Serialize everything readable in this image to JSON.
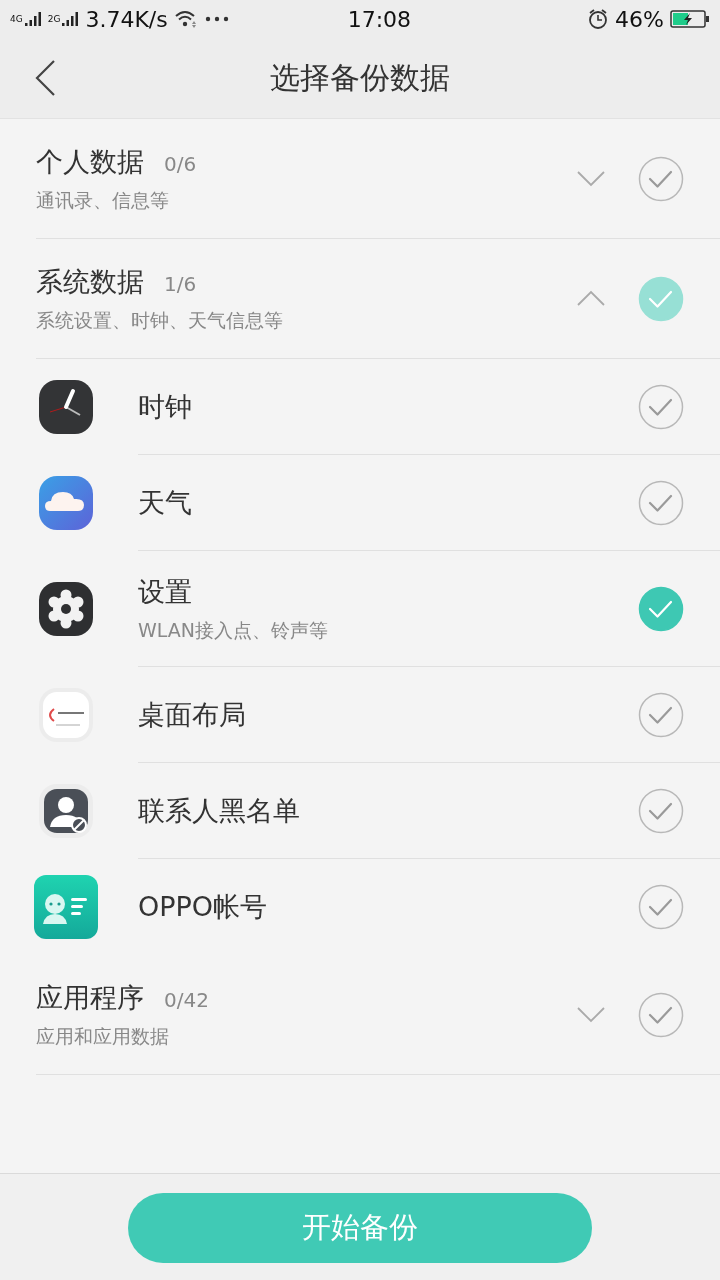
{
  "status_bar": {
    "network_1": "4G",
    "network_2": "2G",
    "speed": "3.74K/s",
    "time": "17:08",
    "battery": "46%"
  },
  "header": {
    "title": "选择备份数据"
  },
  "groups": [
    {
      "title": "个人数据",
      "count": "0/6",
      "subtitle": "通讯录、信息等",
      "expanded": false,
      "checked": false
    },
    {
      "title": "系统数据",
      "count": "1/6",
      "subtitle": "系统设置、时钟、天气信息等",
      "expanded": true,
      "checked": true,
      "partial": true,
      "items": [
        {
          "name": "时钟",
          "checked": false
        },
        {
          "name": "天气",
          "checked": false
        },
        {
          "name": "设置",
          "subtitle": "WLAN接入点、铃声等",
          "checked": true
        },
        {
          "name": "桌面布局",
          "checked": false
        },
        {
          "name": "联系人黑名单",
          "checked": false
        },
        {
          "name": "OPPO帐号",
          "checked": false
        }
      ]
    },
    {
      "title": "应用程序",
      "count": "0/42",
      "subtitle": "应用和应用数据",
      "expanded": false,
      "checked": false
    }
  ],
  "start_button": "开始备份"
}
